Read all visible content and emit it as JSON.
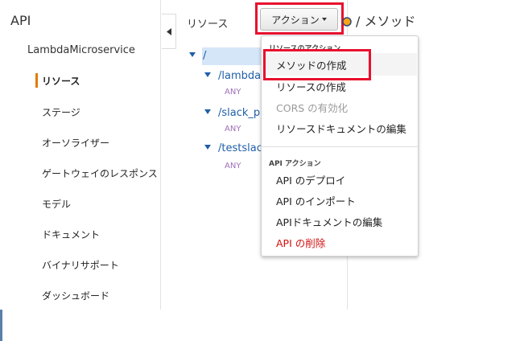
{
  "nav": {
    "api_title": "API",
    "service_name": "LambdaMicroservice",
    "items": [
      {
        "label": "リソース",
        "active": true
      },
      {
        "label": "ステージ"
      },
      {
        "label": "オーソライザー"
      },
      {
        "label": "ゲートウェイのレスポンス"
      },
      {
        "label": "モデル"
      },
      {
        "label": "ドキュメント"
      },
      {
        "label": "バイナリサポート"
      },
      {
        "label": "ダッシュボード"
      }
    ]
  },
  "resources": {
    "header": "リソース",
    "tree": [
      {
        "path": "/",
        "selected": true
      },
      {
        "path": "/lambda",
        "method": "ANY"
      },
      {
        "path": "/slack_p",
        "method": "ANY"
      },
      {
        "path": "/testslac",
        "method": "ANY"
      }
    ]
  },
  "toolbar": {
    "actions_label": "アクション",
    "breadcrumb": "/ メソッド"
  },
  "actions_menu": {
    "section1_label": "リソースのアクション",
    "resource_actions": [
      {
        "label": "メソッドの作成"
      },
      {
        "label": "リソースの作成"
      },
      {
        "label": "CORS の有効化",
        "disabled": true
      },
      {
        "label": "リソースドキュメントの編集"
      }
    ],
    "section2_label": "API アクション",
    "api_actions": [
      {
        "label": "API のデプロイ"
      },
      {
        "label": "API のインポート"
      },
      {
        "label": "APIドキュメントの編集"
      },
      {
        "label": "API の削除",
        "danger": true
      }
    ]
  },
  "colors": {
    "highlight_red": "#e8102e",
    "link_blue": "#1f5fa8",
    "active_orange": "#e07b00",
    "method_purple": "#a070b8",
    "danger_red": "#d10f0f"
  }
}
